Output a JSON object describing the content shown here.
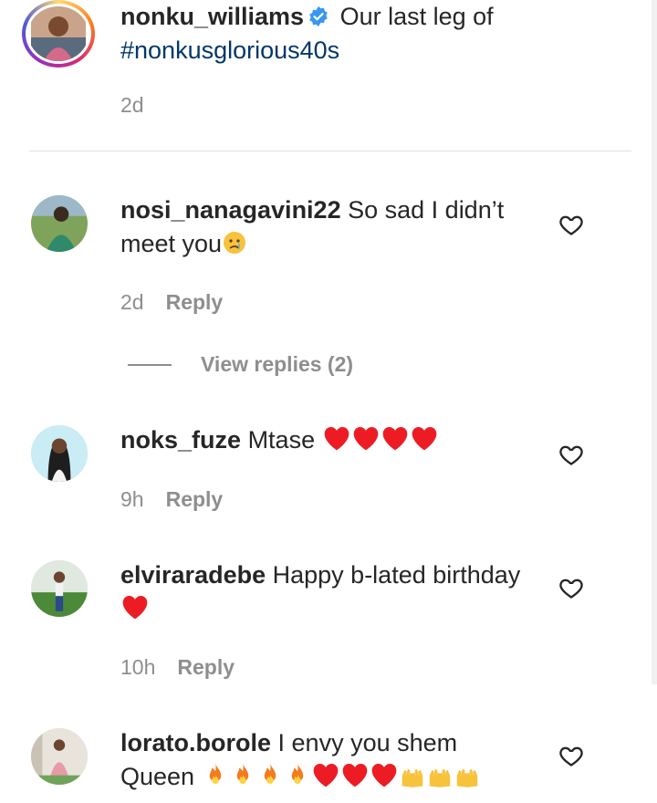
{
  "post": {
    "username": "nonku_williams",
    "caption_line1": "Our last leg of",
    "hashtag": "#nonkusglorious40s",
    "time": "2d",
    "verified_icon": "verified-badge-icon"
  },
  "comments": [
    {
      "username": "nosi_nanagavini22",
      "text_line1": "So sad I didn’t",
      "text_line2": "meet you",
      "time": "2d",
      "reply_label": "Reply",
      "view_replies": "View replies (2)",
      "emoji": [
        "crying-face"
      ]
    },
    {
      "username": "noks_fuze",
      "text_line1": "Mtase",
      "time": "9h",
      "reply_label": "Reply",
      "emoji": [
        "red-heart",
        "red-heart",
        "red-heart",
        "red-heart"
      ]
    },
    {
      "username": "elviraradebe",
      "text_line1": "Happy b-lated birthday",
      "time": "10h",
      "reply_label": "Reply",
      "emoji": [
        "red-heart"
      ]
    },
    {
      "username": "lorato.borole",
      "text_line1": "I envy you shem",
      "text_line2": "Queen",
      "emoji": [
        "fire",
        "fire",
        "fire",
        "fire",
        "red-heart",
        "red-heart",
        "red-heart",
        "raising-hands",
        "raising-hands",
        "raising-hands"
      ]
    }
  ],
  "colors": {
    "text": "#262626",
    "secondary": "#8e8e8e",
    "hashtag": "#00376b",
    "verified": "#3897f0",
    "heart": "#ed1c24"
  }
}
